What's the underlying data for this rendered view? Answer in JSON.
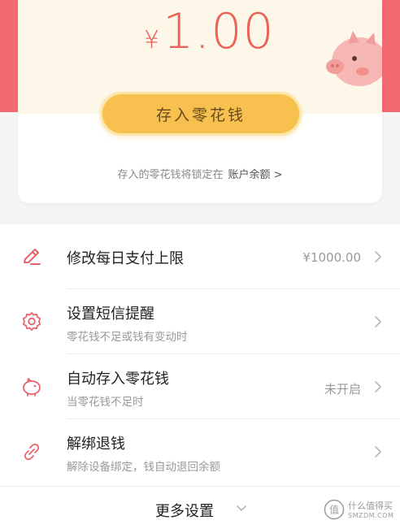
{
  "savings": {
    "currency_symbol": "¥",
    "amount": "1.00",
    "deposit_button_label": "存入零花钱",
    "lock_note_text": "存入的零花钱将锁定在",
    "lock_note_link": "账户余额 >"
  },
  "settings": {
    "items": [
      {
        "icon": "pencil-edit-icon",
        "title": "修改每日支付上限",
        "subtitle": "",
        "value": "¥1000.00"
      },
      {
        "icon": "gear-icon",
        "title": "设置短信提醒",
        "subtitle": "零花钱不足或钱有变动时",
        "value": ""
      },
      {
        "icon": "piggy-bank-icon",
        "title": "自动存入零花钱",
        "subtitle": "当零花钱不足时",
        "value": "未开启"
      },
      {
        "icon": "broken-link-icon",
        "title": "解绑退钱",
        "subtitle": "解除设备绑定，钱自动退回余额",
        "value": ""
      }
    ],
    "more_label": "更多设置"
  },
  "watermark": {
    "logo_char": "值",
    "cn_text": "什么值得买",
    "en_text": "SMZDM.COM"
  },
  "colors": {
    "brand_red": "#f36a72",
    "amount_red": "#ea6356",
    "button_yellow": "#f7c04f",
    "icon_red": "#e8636a"
  }
}
